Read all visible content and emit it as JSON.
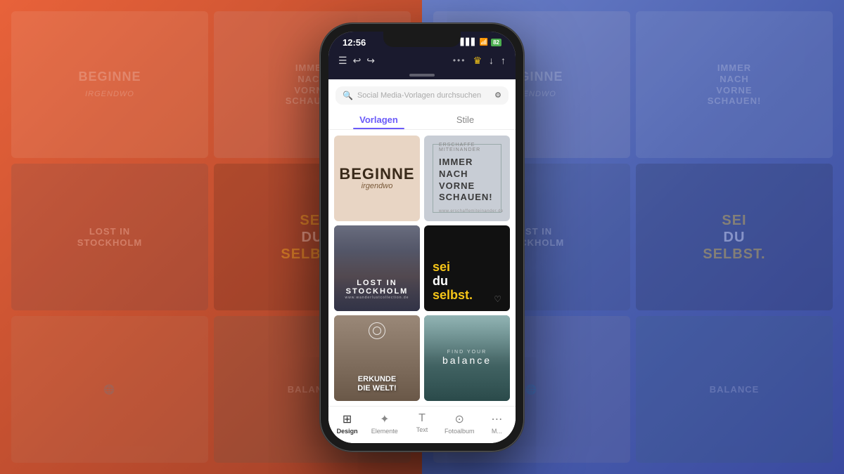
{
  "background": {
    "left_color": "#e8623a",
    "right_color": "#4a5faf"
  },
  "ghost_cards_left": [
    {
      "text": "BEGINNE",
      "type": "beginne"
    },
    {
      "text": "IMMER\nNACH\nVORNE\nSCHAUEN!",
      "type": "immer"
    },
    {
      "text": "LOST IN STOCKHOLM",
      "type": "lost"
    },
    {
      "text": "sei du selbst.",
      "type": "sei"
    },
    {
      "text": "",
      "type": "erkunde"
    },
    {
      "text": "",
      "type": "balance"
    }
  ],
  "status_bar": {
    "time": "12:56",
    "battery": "82"
  },
  "toolbar": {
    "menu_icon": "☰",
    "undo_icon": "↩",
    "redo_icon": "↪",
    "more_icon": "•••",
    "crown_icon": "♛",
    "download_icon": "↓",
    "share_icon": "↑"
  },
  "search": {
    "placeholder": "Social Media-Vorlagen durchsuchen",
    "filter_icon": "⚙"
  },
  "tabs": [
    {
      "label": "Vorlagen",
      "active": true
    },
    {
      "label": "Stile",
      "active": false
    }
  ],
  "templates": [
    {
      "id": "beginne",
      "main_text": "BEGINNE",
      "sub_text": "irgendwo",
      "bg_color": "#e8d5c4"
    },
    {
      "id": "immer",
      "label_text": "ERSCHAFFE MITEINANDER",
      "main_text": "IMMER\nNACH\nVORNE\nSCHAUEN!",
      "footer_text": "www.erschaffemiteinander.de",
      "bg_color": "#c8cdd5"
    },
    {
      "id": "lost",
      "title": "LOST IN STOCKHOLM",
      "sub": "www.wanderlustcollection.de",
      "bg_color": "#3a3a4a"
    },
    {
      "id": "sei",
      "line1": "sei",
      "line2": "du",
      "line3": "selbst.",
      "bg_color": "#111111"
    },
    {
      "id": "erkunde",
      "title": "ERKUNDE\nDIE WELT!",
      "bg_color": "#8a7a6a"
    },
    {
      "id": "balance",
      "find": "FIND YOUR",
      "title": "balance",
      "bg_color": "#4a6a6a"
    }
  ],
  "bottom_nav": [
    {
      "label": "Design",
      "icon": "⊞",
      "active": true
    },
    {
      "label": "Elemente",
      "icon": "✦",
      "active": false
    },
    {
      "label": "Text",
      "icon": "T",
      "active": false
    },
    {
      "label": "Fotoalbum",
      "icon": "⊙",
      "active": false
    },
    {
      "label": "M...",
      "icon": "⋯",
      "active": false
    }
  ]
}
